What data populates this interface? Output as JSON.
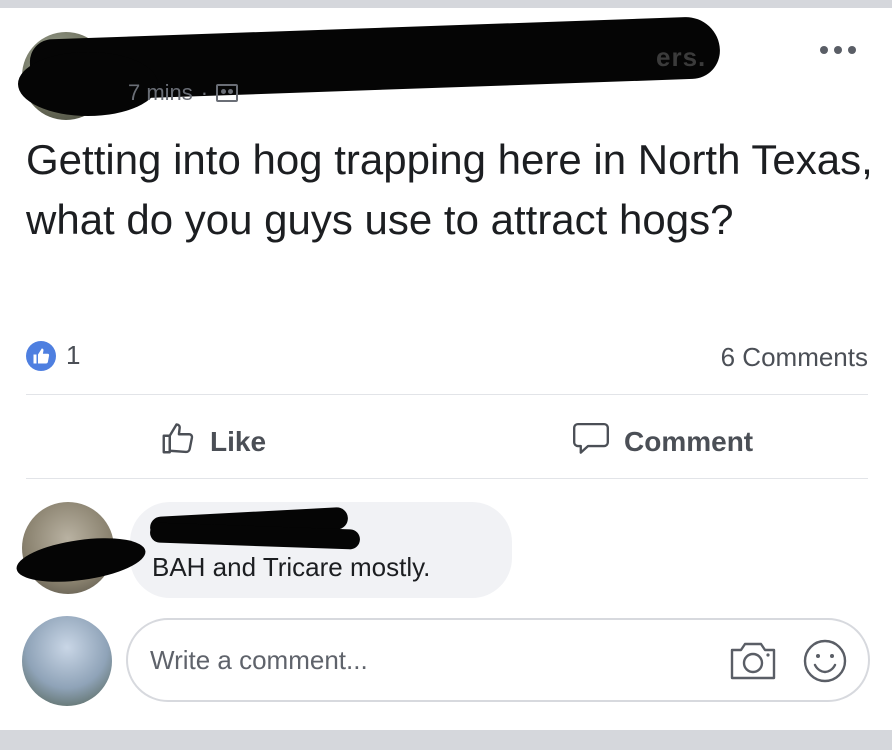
{
  "post": {
    "author_suffix": "ers.",
    "time": "7 mins",
    "separator": "·",
    "text": "Getting into hog trapping here in North Texas, what do you guys use to attract hogs?",
    "like_count": "1",
    "comments_count": "6 Comments"
  },
  "actions": {
    "like_label": "Like",
    "comment_label": "Comment"
  },
  "comments": [
    {
      "text": "BAH and Tricare mostly."
    }
  ],
  "composer": {
    "placeholder": "Write a comment..."
  },
  "colors": {
    "like_blue": "#4e7fe0",
    "text": "#1c1e21",
    "secondary": "#4b4f56"
  },
  "icons": [
    "more-options-icon",
    "audience-icon",
    "like-reaction-icon",
    "thumbs-up-icon",
    "comment-bubble-icon",
    "camera-icon",
    "emoji-icon"
  ]
}
